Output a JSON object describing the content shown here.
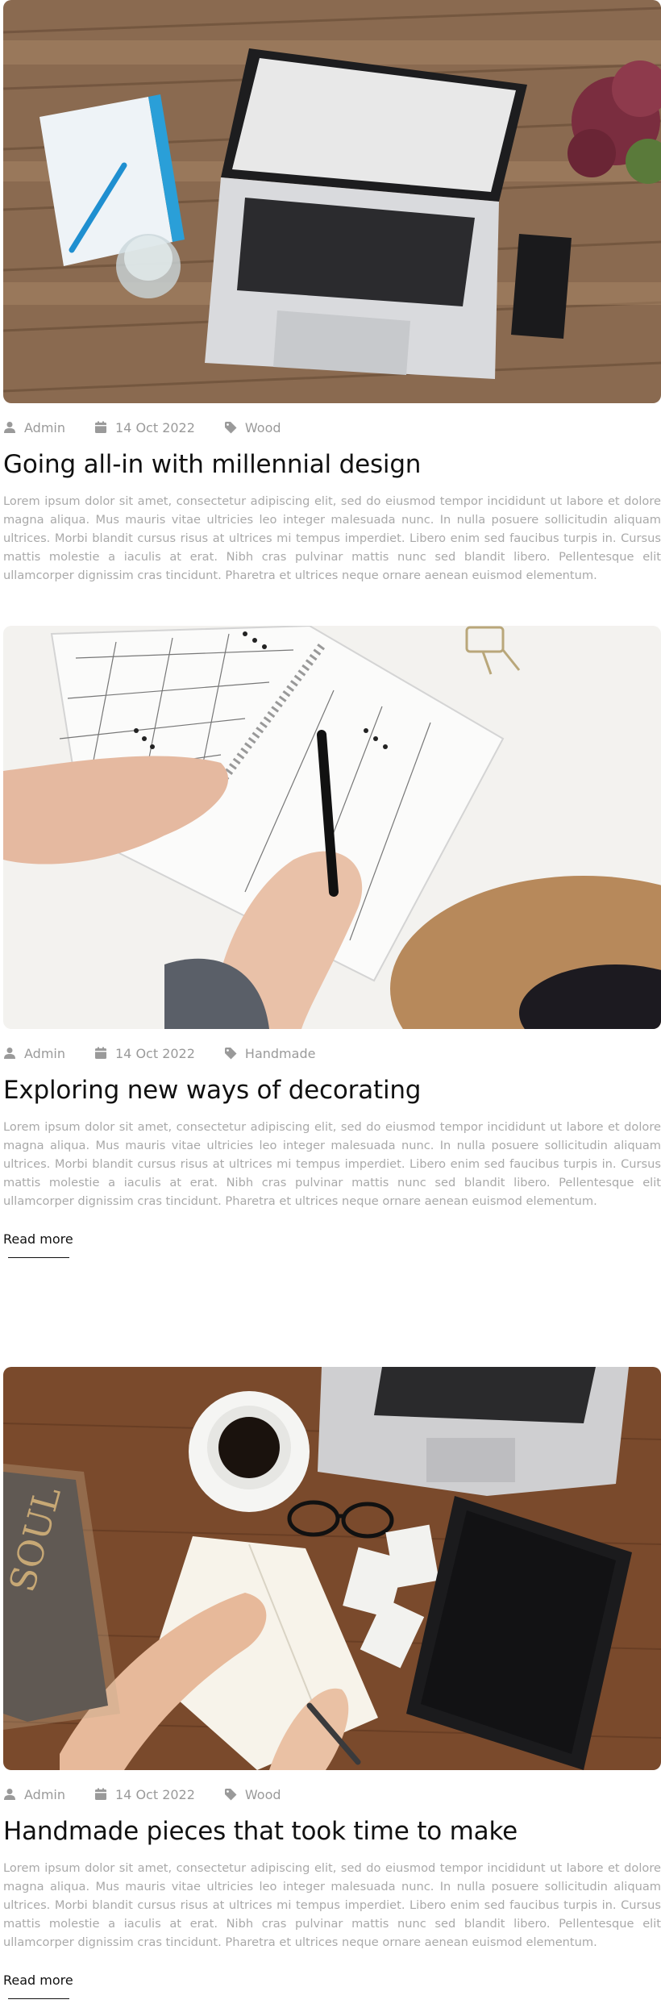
{
  "posts": [
    {
      "author": "Admin",
      "date": "14 Oct 2022",
      "category": "Wood",
      "title": "Going all-in with millennial design",
      "excerpt": "Lorem ipsum dolor sit amet, consectetur adipiscing elit, sed do eiusmod tempor incididunt ut labore et dolore magna aliqua. Mus mauris vitae ultricies leo integer malesuada nunc. In nulla posuere sollicitudin aliquam ultrices. Morbi blandit cursus risus at ultrices mi tempus imperdiet. Libero enim sed faucibus turpis in. Cursus mattis molestie a iaculis at erat. Nibh cras pulvinar mattis nunc sed blandit libero. Pellentesque elit ullamcorper dignissim cras tincidunt. Pharetra et ultrices neque ornare aenean euismod elementum.",
      "read_more": ""
    },
    {
      "author": "Admin",
      "date": "14 Oct 2022",
      "category": "Handmade",
      "title": "Exploring new ways of decorating",
      "excerpt": "Lorem ipsum dolor sit amet, consectetur adipiscing elit, sed do eiusmod tempor incididunt ut labore et dolore magna aliqua. Mus mauris vitae ultricies leo integer malesuada nunc. In nulla posuere sollicitudin aliquam ultrices. Morbi blandit cursus risus at ultrices mi tempus imperdiet. Libero enim sed faucibus turpis in. Cursus mattis molestie a iaculis at erat. Nibh cras pulvinar mattis nunc sed blandit libero. Pellentesque elit ullamcorper dignissim cras tincidunt. Pharetra et ultrices neque ornare aenean euismod elementum.",
      "read_more": "Read more"
    },
    {
      "author": "Admin",
      "date": "14 Oct 2022",
      "category": "Wood",
      "title": "Handmade pieces that took time to make",
      "excerpt": "Lorem ipsum dolor sit amet, consectetur adipiscing elit, sed do eiusmod tempor incididunt ut labore et dolore magna aliqua. Mus mauris vitae ultricies leo integer malesuada nunc. In nulla posuere sollicitudin aliquam ultrices. Morbi blandit cursus risus at ultrices mi tempus imperdiet. Libero enim sed faucibus turpis in. Cursus mattis molestie a iaculis at erat. Nibh cras pulvinar mattis nunc sed blandit libero. Pellentesque elit ullamcorper dignissim cras tincidunt. Pharetra et ultrices neque ornare aenean euismod elementum.",
      "read_more": "Read more"
    }
  ],
  "icons": {
    "author": "user-icon",
    "date": "calendar-icon",
    "category": "tag-icon"
  },
  "colors": {
    "meta": "#9a9a9a",
    "excerpt": "#a9a9a9",
    "title": "#111111"
  }
}
